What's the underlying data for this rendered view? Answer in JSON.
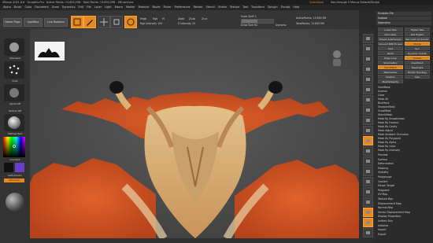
{
  "titlebar": {
    "text": "ZBrush 2021.6.6 · Sculptris Pro · Active Points: 13,650,598 · Total Points: 13,650,598 · ZBrushCore",
    "quicksave": "QuickSave",
    "right_items": "See-through 0  Menus  DefaultZScript"
  },
  "menubar": {
    "items": [
      "Alpha",
      "Brush",
      "Color",
      "Document",
      "Draw",
      "Dynamics",
      "Edit",
      "File",
      "Layer",
      "Light",
      "Macro",
      "Marker",
      "Material",
      "Movie",
      "Picker",
      "Preferences",
      "Render",
      "Stencil",
      "Stroke",
      "Texture",
      "Tool",
      "Transform",
      "Zplugin",
      "Zscript",
      "Help"
    ]
  },
  "shelf": {
    "buttons": [
      "Home Page",
      "LightBox",
      "Live Boolean"
    ],
    "tools": [
      "Edit",
      "Draw",
      "Move",
      "Scale",
      "Rotate"
    ],
    "mrgb": "Mrgb",
    "rgb": "Rgb",
    "m": "M",
    "zadd": "Zadd",
    "zsub": "Zsub",
    "zcut": "Zcut",
    "focal_shift": "Focal Shift 0",
    "draw_size": "Draw Size 64",
    "rgb_intensity": "Rgb Intensity 100",
    "z_intensity": "Z Intensity 25",
    "active_points": "ActivePoints: 13.650 Mil",
    "total_points": "TotalPoints: 13.650 Mil",
    "dynamic": "Dynamic"
  },
  "lefttray": {
    "brush_label": "Standard",
    "stroke_label": "Dots",
    "alpha_label": "Alpha Off",
    "texture_label": "Texture Off",
    "material_label": "MatCap Red",
    "gradient_label": "Gradient",
    "switch_color": "SwitchColor",
    "alternate": "Alternate"
  },
  "rightbar": {
    "items": [
      "BPR",
      "SPix 3",
      "Scroll",
      "Zoom",
      "Actual",
      "AAHalf",
      "Persp",
      "Floor",
      "Local",
      "L.Sym",
      "Frame",
      "Move",
      "Scale",
      "Rotate",
      "Line Fill",
      "PolyF",
      "Transp",
      "Ghost",
      "Solo",
      "Xpose"
    ]
  },
  "rightpanel": {
    "header_items": [
      "Sculptris Pro",
      "Subtool",
      "Geometry"
    ],
    "top_items": [
      "Preview",
      "Surface",
      "Deformation",
      "Masking",
      "Visibility",
      "Polygroups",
      "Contact",
      "Morph Target",
      "Polypaint",
      "UV Map",
      "Texture Map",
      "Displacement Map",
      "Normal Map",
      "Vector Displacement Map",
      "Display Properties",
      "Unified Skin",
      "Initialize",
      "Import",
      "Export"
    ],
    "rows": [
      "Lower Res",
      "Higher Res",
      "Del Lower",
      "Del Higher",
      "Freeze SubDivision Levels",
      "Reconstruct Subdiv",
      "Convert BPR To Geo",
      "Divide",
      "Smt",
      "Suv",
      "ReUV",
      "Dynamic Subdiv",
      "Edge Loop",
      "Crease",
      "ShadowBox",
      "ClayPolish",
      "DynaMesh",
      "Tessimate",
      "ZRemesher",
      "Modify Topology",
      "Position",
      "Size",
      "MeshIntegrity"
    ],
    "masking_rows": [
      "ViewMask",
      "Inverse",
      "Clear",
      "Mask All",
      "BlurMask",
      "SharpenMask",
      "GrowMask",
      "ShrinkMask",
      "Mask By Smoothness",
      "Mask By Feature",
      "Mask By Cavity",
      "Mask Adjust",
      "Mask Ambient Occlusion",
      "Mask By Polypaint",
      "Mask By Alpha",
      "Mask By Color",
      "Mask By Intensity"
    ]
  },
  "canvas": {
    "bottom_text": "· · · · · · · · · · · · · · ·"
  },
  "colors": {
    "accent": "#e8891a",
    "background": "#4b4b4b",
    "creature_base": "#d07a3a"
  }
}
